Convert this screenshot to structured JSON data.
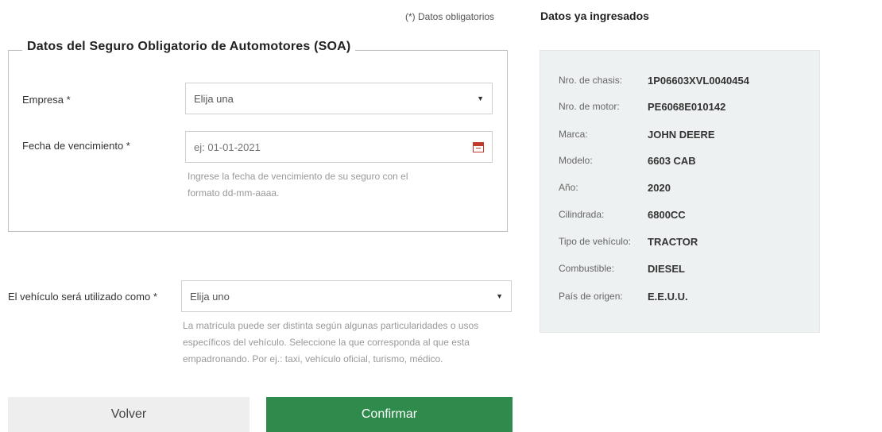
{
  "required_note": "(*) Datos obligatorios",
  "soa": {
    "legend": "Datos del Seguro Obligatorio de Automotores (SOA)",
    "empresa": {
      "label": "Empresa *",
      "value": "Elija una"
    },
    "fecha": {
      "label": "Fecha de vencimiento *",
      "placeholder": "ej: 01-01-2021",
      "help_line1": "Ingrese la fecha de vencimiento de su seguro con el",
      "help_line2": "formato dd-mm-aaaa."
    }
  },
  "uso": {
    "label": "El vehículo será utilizado como *",
    "value": "Elija uno",
    "help_line1": "La matrícula puede ser distinta según algunas particularidades o usos",
    "help_line2": "específicos del vehículo. Seleccione la que corresponda al que esta",
    "help_line3": "empadronando. Por ej.: taxi, vehículo oficial, turismo, médico."
  },
  "buttons": {
    "back": "Volver",
    "confirm": "Confirmar"
  },
  "side": {
    "title": "Datos ya ingresados",
    "rows": [
      {
        "key": "Nro. de chasis:",
        "value": "1P06603XVL0040454"
      },
      {
        "key": "Nro. de motor:",
        "value": "PE6068E010142"
      },
      {
        "key": "Marca:",
        "value": "JOHN DEERE"
      },
      {
        "key": "Modelo:",
        "value": "6603 CAB"
      },
      {
        "key": "Año:",
        "value": "2020"
      },
      {
        "key": "Cilindrada:",
        "value": "6800CC"
      },
      {
        "key": "Tipo de vehículo:",
        "value": "TRACTOR"
      },
      {
        "key": "Combustible:",
        "value": "DIESEL"
      },
      {
        "key": "País de origen:",
        "value": "E.E.U.U."
      }
    ]
  },
  "icons": {
    "calendar": "calendar-icon",
    "caret": "caret-down-icon"
  },
  "colors": {
    "confirm": "#2e8b4c",
    "back": "#eeeeee",
    "side_bg": "#eef1f2",
    "calendar": "#c0392b"
  }
}
